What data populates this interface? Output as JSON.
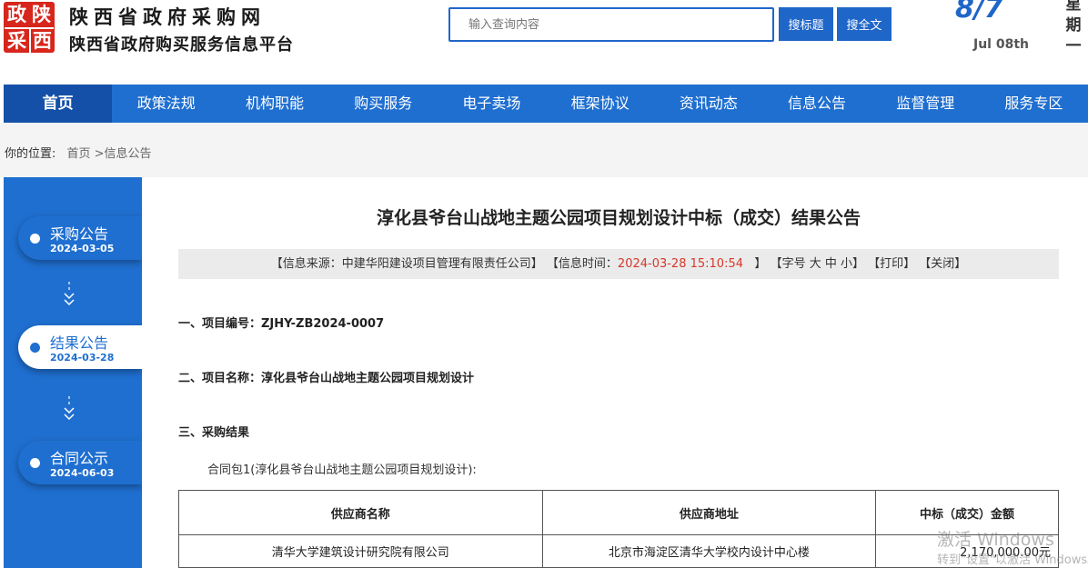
{
  "header": {
    "logo_chars": [
      "政",
      "陕",
      "采",
      "西"
    ],
    "site_name": "陕西省政府采购网",
    "site_subtitle": "陕西省政府购买服务信息平台",
    "search_placeholder": "输入查询内容",
    "search_title_label": "搜标题",
    "search_full_label": "搜全文",
    "date_big": "8/7",
    "date_small": "Jul 08th",
    "weekday_chars": [
      "星",
      "期",
      "一"
    ]
  },
  "nav": {
    "items": [
      "首页",
      "政策法规",
      "机构职能",
      "购买服务",
      "电子卖场",
      "框架协议",
      "资讯动态",
      "信息公告",
      "监督管理",
      "服务专区"
    ],
    "active": "首页"
  },
  "breadcrumb": {
    "prefix": "你的位置:",
    "path": "首页 >信息公告"
  },
  "timeline": [
    {
      "label": "采购公告",
      "date": "2024-03-05",
      "active": false
    },
    {
      "label": "结果公告",
      "date": "2024-03-28",
      "active": true
    },
    {
      "label": "合同公示",
      "date": "2024-06-03",
      "active": false
    }
  ],
  "article": {
    "title": "淳化县爷台山战地主题公园项目规划设计中标（成交）结果公告",
    "meta": {
      "source_prefix": "【信息来源：",
      "source": "中建华阳建设项目管理有限责任公司",
      "source_suffix": "】",
      "time_prefix": "【信息时间：",
      "time": "2024-03-28 15:10:54",
      "time_suffix": "】",
      "font_size": "【字号 大 中 小】",
      "print": "【打印】",
      "close": "【关闭】"
    },
    "section1": "一、项目编号：ZJHY-ZB2024-0007",
    "section2": "二、项目名称：淳化县爷台山战地主题公园项目规划设计",
    "section3": "三、采购结果",
    "package": "合同包1(淳化县爷台山战地主题公园项目规划设计):",
    "table": {
      "headers": [
        "供应商名称",
        "供应商地址",
        "中标（成交）金额"
      ],
      "rows": [
        [
          "清华大学建筑设计研究院有限公司",
          "北京市海淀区清华大学校内设计中心楼",
          "2,170,000.00元"
        ]
      ]
    }
  },
  "watermark": {
    "line1": "激活 Windows",
    "line2": "转到\"设置\"以激活 Windows。"
  },
  "colors": {
    "primary": "#1f6fd0",
    "nav_active": "#1450a8",
    "logo_red": "#d7261c",
    "time_red": "#d6382c"
  }
}
